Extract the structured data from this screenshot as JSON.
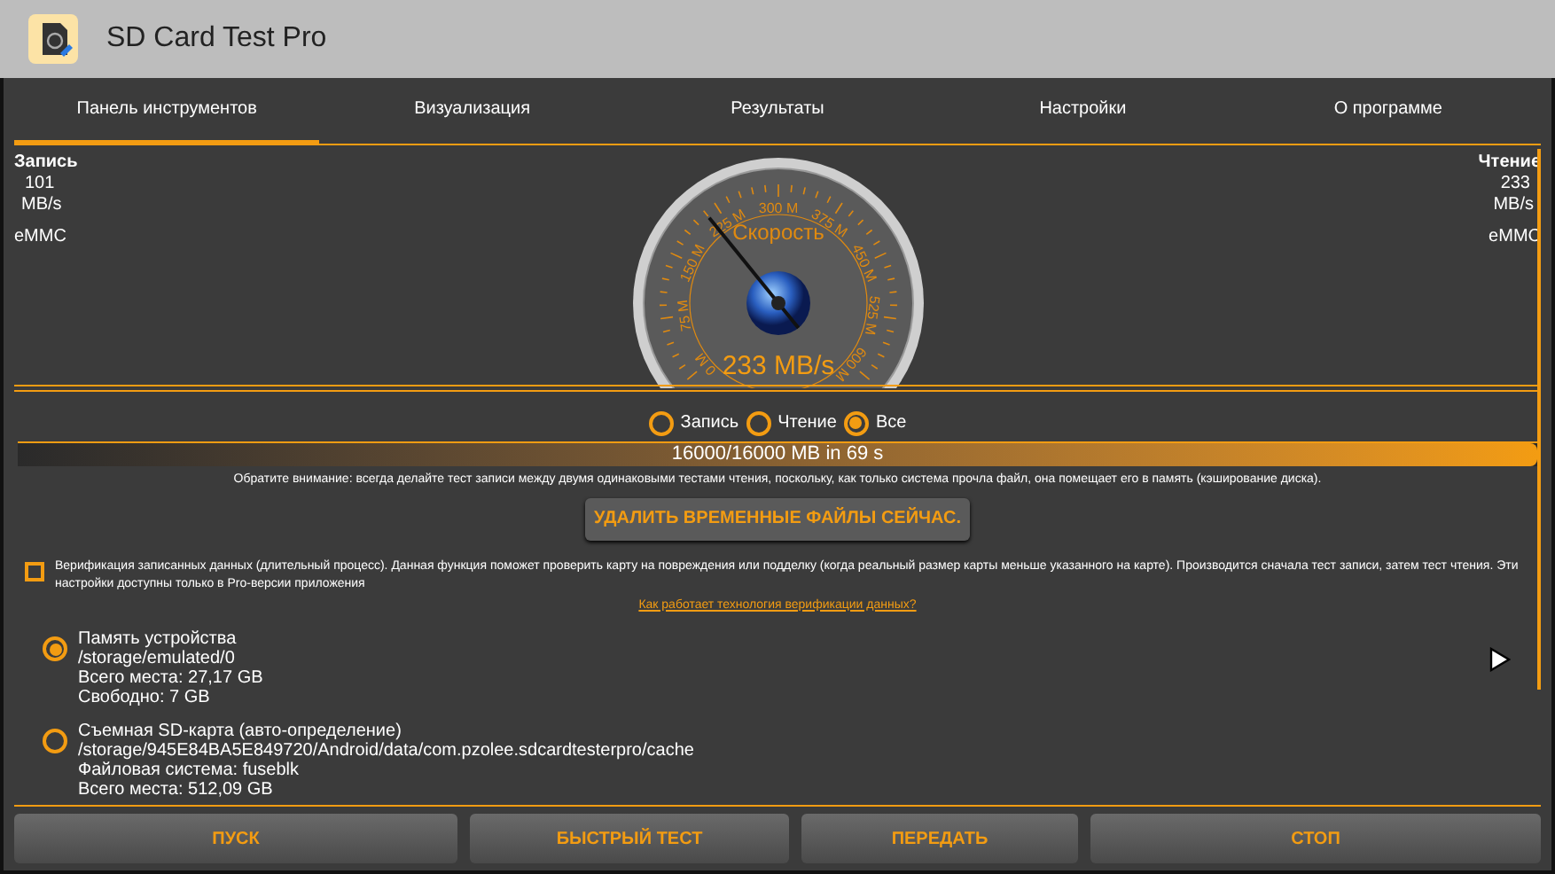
{
  "app_bar": {
    "title": "SD Card Test Pro"
  },
  "tabs": [
    {
      "label": "Панель инструментов",
      "selected": true
    },
    {
      "label": "Визуализация",
      "selected": false
    },
    {
      "label": "Результаты",
      "selected": false
    },
    {
      "label": "Настройки",
      "selected": false
    },
    {
      "label": "О программе",
      "selected": false
    }
  ],
  "write_stats": {
    "label": "Запись",
    "speed": "101",
    "unit": "MB/s",
    "type": "eMMC"
  },
  "read_stats": {
    "label": "Чтение",
    "speed": "233",
    "unit": "MB/s",
    "type": "eMMC"
  },
  "gauge": {
    "title": "Скорость",
    "reading": "233 MB/s",
    "level": 0.35,
    "scale_labels": [
      "0 M",
      "75 M",
      "150 M",
      "225 M",
      "300 M",
      "375 M",
      "450 M",
      "525 M",
      "600 M"
    ]
  },
  "modes": [
    {
      "label": "Запись",
      "selected": false
    },
    {
      "label": "Чтение",
      "selected": false
    },
    {
      "label": "Все",
      "selected": true
    }
  ],
  "progress": {
    "label": "16000/16000 MB in 69 s",
    "level": 1.0
  },
  "note": "Обратите внимание: всегда делайте тест записи между двумя одинаковыми тестами чтения, поскольку, как только система прочла файл, она помещает его в память (кэширование диска).",
  "delete_button": "УДАЛИТЬ ВРЕМЕННЫЕ ФАЙЛЫ СЕЙЧАС.",
  "verification": {
    "checked": false,
    "text": "Верификация записанных данных (длительный процесс). Данная функция поможет проверить карту на повреждения или подделку (когда реальный размер карты меньше указанного на карте). Производится сначала тест записи, затем тест чтения. Эти настройки доступны только в Pro-версии приложения",
    "link": "Как работает технология верификации данных?"
  },
  "storage": [
    {
      "selected": true,
      "lines": [
        "Память устройства",
        "/storage/emulated/0",
        "Всего места: 27,17 GB",
        "Свободно: 7 GB"
      ]
    },
    {
      "selected": false,
      "lines": [
        "Съемная SD-карта (авто-определение)",
        "/storage/945E84BA5E849720/Android/data/com.pzolee.sdcardtesterpro/cache",
        "Файловая система: fuseblk",
        "Всего места: 512,09 GB"
      ]
    }
  ],
  "buttons": [
    "ПУСК",
    "БЫСТРЫЙ ТЕСТ",
    "ПЕРЕДАТЬ",
    "СТОП"
  ]
}
